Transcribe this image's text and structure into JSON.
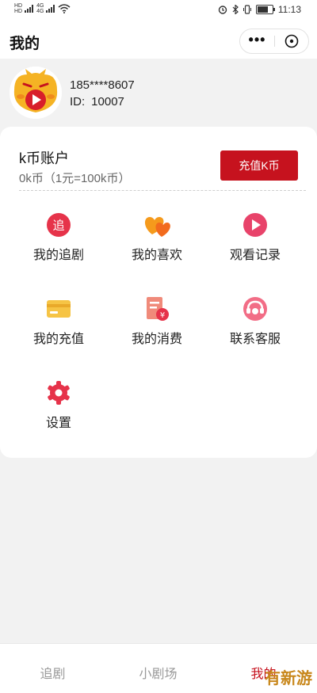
{
  "status_bar": {
    "time": "11:13",
    "left_labels": [
      "HD",
      "4G",
      "HD",
      "4G"
    ]
  },
  "header": {
    "title": "我的",
    "more_label": "•••"
  },
  "profile": {
    "phone": "185****8607",
    "id_label": "ID:",
    "id_value": "10007"
  },
  "account": {
    "title": "k币账户",
    "balance": "0k币（1元=100k币）",
    "recharge_label": "充值K币"
  },
  "menu": [
    {
      "label": "我的追剧",
      "icon": "follow-drama-icon"
    },
    {
      "label": "我的喜欢",
      "icon": "hearts-icon"
    },
    {
      "label": "观看记录",
      "icon": "play-history-icon"
    },
    {
      "label": "我的充值",
      "icon": "card-icon"
    },
    {
      "label": "我的消费",
      "icon": "bill-icon"
    },
    {
      "label": "联系客服",
      "icon": "service-icon"
    },
    {
      "label": "设置",
      "icon": "gear-icon"
    }
  ],
  "bottom_nav": [
    {
      "label": "追剧"
    },
    {
      "label": "小剧场"
    },
    {
      "label": "我的"
    }
  ],
  "watermark": "有新游",
  "colors": {
    "brand_red": "#c6121e",
    "icon_red": "#e6334a",
    "icon_orange": "#f59a1c",
    "icon_yellow": "#f6c445"
  }
}
